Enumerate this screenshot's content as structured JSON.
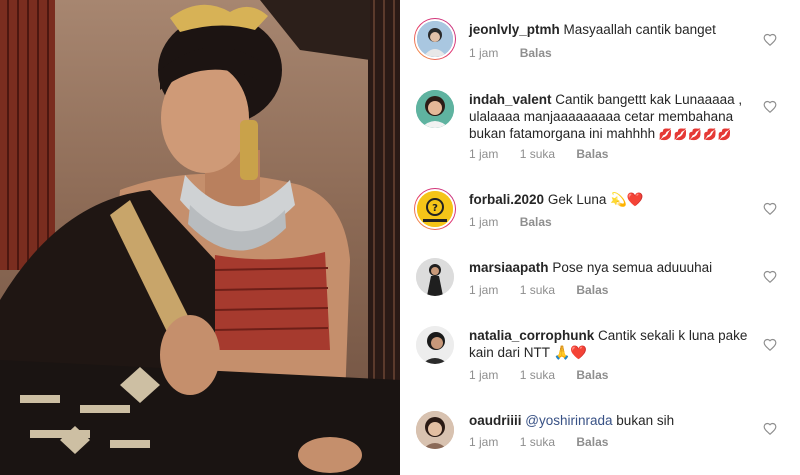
{
  "comments": [
    {
      "username": "jeonlvly_ptmh",
      "text": "Masyaallah cantik banget",
      "time": "1 jam",
      "likes": "",
      "reply": "Balas",
      "has_story_ring": true,
      "avatar_color": "#6b9ec7"
    },
    {
      "username": "indah_valent",
      "text": "Cantik bangettt kak Lunaaaaa , ulalaaaa manjaaaaaaaaa cetar membahana bukan fatamorgana ini mahhhh",
      "emoji": "💋💋💋💋💋",
      "time": "1 jam",
      "likes": "1 suka",
      "reply": "Balas",
      "has_story_ring": false,
      "avatar_color": "#4aa88f"
    },
    {
      "username": "forbali.2020",
      "text": "Gek Luna",
      "emoji": "💫❤️",
      "time": "1 jam",
      "likes": "",
      "reply": "Balas",
      "has_story_ring": true,
      "avatar_color": "#f5c518",
      "avatar_text": "BALI BEBE AID"
    },
    {
      "username": "marsiaapath",
      "text": "Pose nya semua aduuuhai",
      "time": "1 jam",
      "likes": "1 suka",
      "reply": "Balas",
      "has_story_ring": false,
      "avatar_color": "#3a3a3a"
    },
    {
      "username": "natalia_corrophunk",
      "text": "Cantik sekali k luna pake kain dari NTT",
      "emoji": "🙏❤️",
      "time": "1 jam",
      "likes": "1 suka",
      "reply": "Balas",
      "has_story_ring": false,
      "avatar_color": "#222222"
    },
    {
      "username": "oaudriiii",
      "mention": "@yoshirinrada",
      "text": "bukan sih",
      "time": "1 jam",
      "likes": "1 suka",
      "reply": "Balas",
      "has_story_ring": false,
      "avatar_color": "#c9a48a"
    }
  ],
  "colors": {
    "text": "#262626",
    "meta": "#8e8e8e",
    "mention": "#385185",
    "heart_outline": "#8e8e8e"
  },
  "icons": {
    "like": "heart-outline-icon"
  }
}
